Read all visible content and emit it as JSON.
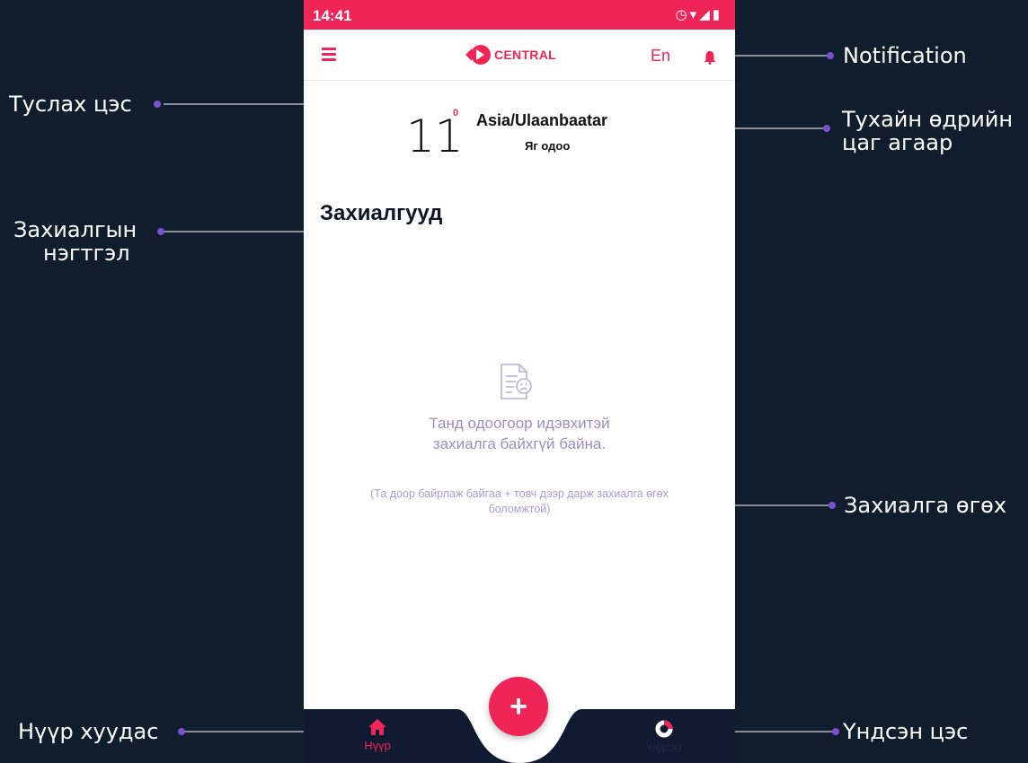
{
  "annotations": {
    "side_menu": "Туслах цэс",
    "order_summary_line1": "Захиалгын",
    "order_summary_line2": "нэгтгэл",
    "home_page": "Нүүр хуудас",
    "notification": "Notification",
    "weather_line1": "Тухайн өдрийн",
    "weather_line2": "цаг агаар",
    "place_order": "Захиалга өгөх",
    "main_menu": "Үндсэн цэс"
  },
  "phone": {
    "status_time": "14:41",
    "app": {
      "brand": "CENTRAL",
      "lang": "En"
    },
    "weather": {
      "temp": "11",
      "degree": "0",
      "city": "Asia/Ulaanbaatar",
      "now": "Яг одоо"
    },
    "orders": {
      "title": "Захиалгууд",
      "empty_main": "Танд одоогоор идэвхитэй захиалга байхгүй байна.",
      "empty_sub": "(Та доор байрлаж байгаа + товч дээр дарж захиалга өгөх боломжтой)"
    },
    "nav": {
      "home_label": "Нүүр",
      "menu_label": "Үндсэн",
      "fab_label": "+"
    }
  },
  "colors": {
    "accent": "#ee2556",
    "background": "#0f1d2c",
    "nav": "#101a30",
    "annotation_dot": "#7b4fd0"
  }
}
